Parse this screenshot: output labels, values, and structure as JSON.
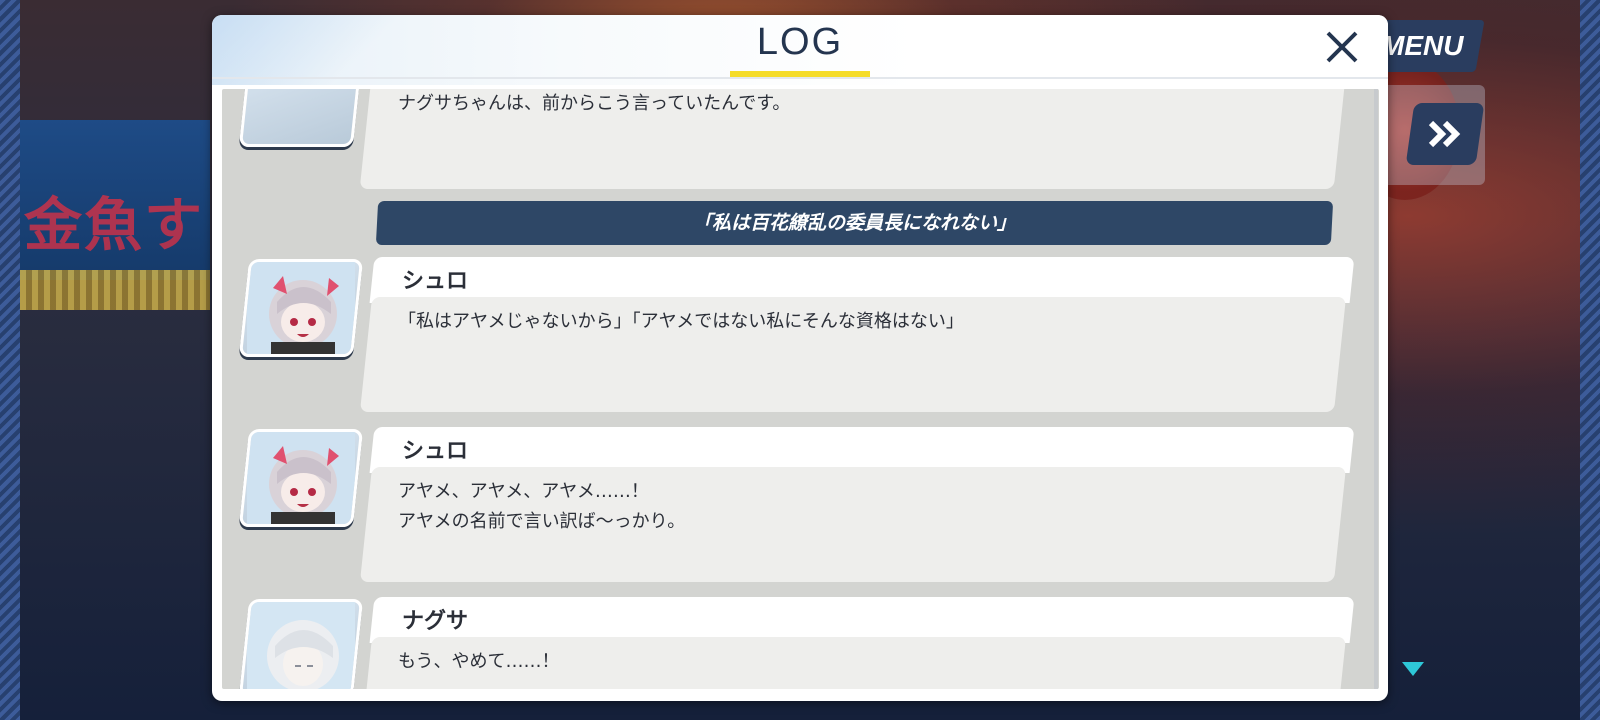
{
  "header": {
    "title": "LOG"
  },
  "hud": {
    "menu_label": "MENU",
    "fast_forward_icon": "double-chevron-right-icon",
    "scroll_more_icon": "triangle-down-icon"
  },
  "background_sign_text": "金魚す",
  "entries": [
    {
      "type": "message",
      "speaker": "",
      "avatar": "shuro-portrait",
      "lines": "ナグサちゃんは、前からこう言っていたんです。"
    },
    {
      "type": "narration",
      "text": "「私は百花繚乱の委員長になれない」"
    },
    {
      "type": "message",
      "speaker": "シュロ",
      "avatar": "shuro-portrait",
      "lines": "「私はアヤメじゃないから」「アヤメではない私にそんな資格はない」"
    },
    {
      "type": "message",
      "speaker": "シュロ",
      "avatar": "shuro-portrait",
      "lines": "アヤメ、アヤメ、アヤメ……！\nアヤメの名前で言い訳ば〜っかり。"
    },
    {
      "type": "message",
      "speaker": "ナグサ",
      "avatar": "nagusa-portrait",
      "lines": "もう、やめて……！"
    }
  ],
  "colors": {
    "accent_yellow": "#f5dc2a",
    "navy": "#2e4766",
    "title": "#24354f",
    "scroll_arrow": "#2ec8d8"
  }
}
